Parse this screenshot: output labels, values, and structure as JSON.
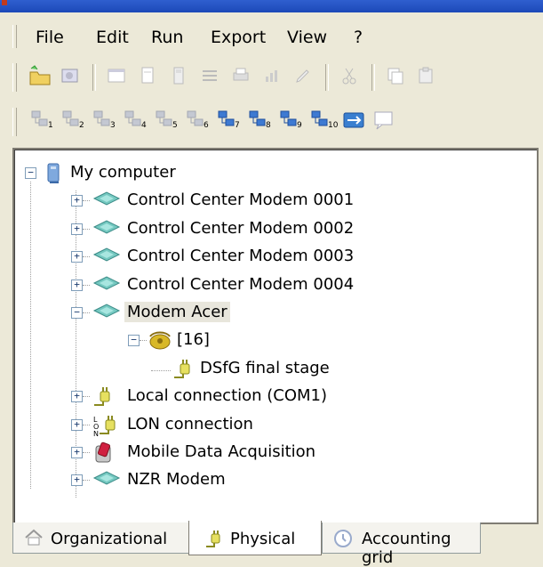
{
  "menu": [
    "File",
    "Edit",
    "Run",
    "Export",
    "View",
    "?"
  ],
  "toolbar1": {
    "buttons": [
      "new-folder-icon",
      "properties-icon",
      "window-icon",
      "document-icon",
      "calculator-icon",
      "list-icon",
      "printer-icon",
      "chart-icon",
      "edit-icon",
      "cut-icon",
      "copy-icon",
      "paste-icon"
    ]
  },
  "toolbar2": {
    "buttons": [
      {
        "icon": "route-1-icon",
        "sub": "1"
      },
      {
        "icon": "route-2-icon",
        "sub": "2"
      },
      {
        "icon": "route-3-icon",
        "sub": "3"
      },
      {
        "icon": "route-4-icon",
        "sub": "4"
      },
      {
        "icon": "route-5-icon",
        "sub": "5"
      },
      {
        "icon": "route-6-icon",
        "sub": "6"
      },
      {
        "icon": "route-7-icon",
        "sub": "7"
      },
      {
        "icon": "route-8-icon",
        "sub": "8"
      },
      {
        "icon": "route-9-icon",
        "sub": "9"
      },
      {
        "icon": "route-10-icon",
        "sub": "10"
      },
      {
        "icon": "transfer-icon"
      },
      {
        "icon": "message-icon"
      }
    ]
  },
  "tree": [
    {
      "label": "My computer",
      "level": 0,
      "expander": "−",
      "icon": "computer-icon"
    },
    {
      "label": "Control Center Modem 0001",
      "level": 1,
      "expander": "+",
      "icon": "modem-icon"
    },
    {
      "label": "Control Center Modem 0002",
      "level": 1,
      "expander": "+",
      "icon": "modem-icon"
    },
    {
      "label": "Control Center Modem 0003",
      "level": 1,
      "expander": "+",
      "icon": "modem-icon"
    },
    {
      "label": "Control Center Modem 0004",
      "level": 1,
      "expander": "+",
      "icon": "modem-icon"
    },
    {
      "label": "Modem Acer",
      "level": 1,
      "expander": "−",
      "icon": "modem-icon",
      "selected": true
    },
    {
      "label": "[16]",
      "level": 2,
      "expander": "−",
      "icon": "phone-icon"
    },
    {
      "label": "DSfG final stage",
      "level": 3,
      "expander": "",
      "icon": "plug-icon"
    },
    {
      "label": "Local connection (COM1)",
      "level": 1,
      "expander": "+",
      "icon": "plug-icon"
    },
    {
      "label": "LON connection",
      "level": 1,
      "expander": "+",
      "icon": "lon-icon"
    },
    {
      "label": "Mobile Data Acquisition",
      "level": 1,
      "expander": "+",
      "icon": "mobile-device-icon"
    },
    {
      "label": "NZR Modem",
      "level": 1,
      "expander": "+",
      "icon": "modem-icon"
    }
  ],
  "tabs": [
    {
      "label": "Organizational",
      "icon": "house-icon"
    },
    {
      "label": "Physical",
      "icon": "plug-icon",
      "active": true
    },
    {
      "label": "Accounting grid",
      "icon": "clock-icon"
    }
  ]
}
